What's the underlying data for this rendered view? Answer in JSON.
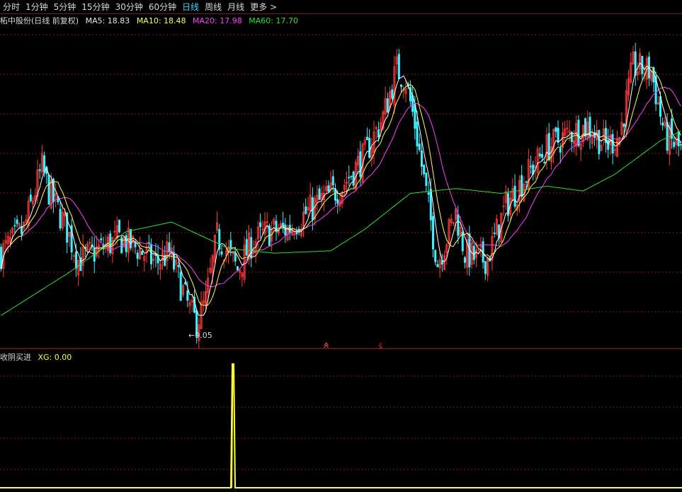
{
  "toolbar": {
    "tabs": [
      "分时",
      "1分钟",
      "5分钟",
      "15分钟",
      "30分钟",
      "60分钟",
      "日线",
      "周线",
      "月线",
      "更多"
    ],
    "active": "日线",
    "more_arrow": ">"
  },
  "header": {
    "stock": "柘中股份(日线 前复权)",
    "ma5": "MA5: 18.83",
    "ma10": "MA10: 18.48",
    "ma20": "MA20: 17.98",
    "ma60": "MA60: 17.70"
  },
  "annotations": {
    "low_label": "←9.05"
  },
  "indicator": {
    "name": "收阴买进",
    "xg": "XG: 0.00"
  },
  "colors": {
    "up": "#ff3a3a",
    "down": "#3ff0ff",
    "ma5": "#ffffff",
    "ma10": "#ffff55",
    "ma20": "#ff40ff",
    "ma60": "#30e030",
    "grid": "#7a1f1f",
    "xg": "#ffff30"
  },
  "chart_data": {
    "type": "candlestick",
    "price_range": [
      9.0,
      22.0
    ],
    "xg_signal_index": 102,
    "xg_range": [
      0,
      1
    ],
    "anchor_prices": [
      {
        "i": 0,
        "p": 12.6
      },
      {
        "i": 10,
        "p": 13.6
      },
      {
        "i": 18,
        "p": 16.2
      },
      {
        "i": 21,
        "p": 15.2
      },
      {
        "i": 28,
        "p": 13.8
      },
      {
        "i": 34,
        "p": 12.3
      },
      {
        "i": 42,
        "p": 12.7
      },
      {
        "i": 52,
        "p": 13.2
      },
      {
        "i": 60,
        "p": 12.8
      },
      {
        "i": 68,
        "p": 12.2
      },
      {
        "i": 74,
        "p": 12.6
      },
      {
        "i": 83,
        "p": 10.2
      },
      {
        "i": 86,
        "p": 9.7
      },
      {
        "i": 90,
        "p": 10.6
      },
      {
        "i": 95,
        "p": 13.3
      },
      {
        "i": 100,
        "p": 12.6
      },
      {
        "i": 104,
        "p": 11.9
      },
      {
        "i": 110,
        "p": 13.0
      },
      {
        "i": 117,
        "p": 13.5
      },
      {
        "i": 126,
        "p": 13.6
      },
      {
        "i": 138,
        "p": 14.6
      },
      {
        "i": 150,
        "p": 15.4
      },
      {
        "i": 160,
        "p": 16.7
      },
      {
        "i": 168,
        "p": 18.3
      },
      {
        "i": 174,
        "p": 20.3
      },
      {
        "i": 178,
        "p": 19.8
      },
      {
        "i": 182,
        "p": 18.0
      },
      {
        "i": 188,
        "p": 14.5
      },
      {
        "i": 192,
        "p": 12.2
      },
      {
        "i": 197,
        "p": 13.5
      },
      {
        "i": 200,
        "p": 14.3
      },
      {
        "i": 204,
        "p": 12.6
      },
      {
        "i": 210,
        "p": 12.3
      },
      {
        "i": 214,
        "p": 12.4
      },
      {
        "i": 222,
        "p": 14.6
      },
      {
        "i": 230,
        "p": 15.7
      },
      {
        "i": 240,
        "p": 17.0
      },
      {
        "i": 250,
        "p": 17.6
      },
      {
        "i": 258,
        "p": 17.9
      },
      {
        "i": 266,
        "p": 17.1
      },
      {
        "i": 272,
        "p": 17.5
      },
      {
        "i": 278,
        "p": 20.4
      },
      {
        "i": 286,
        "p": 20.2
      },
      {
        "i": 292,
        "p": 17.5
      },
      {
        "i": 299,
        "p": 16.9
      }
    ],
    "ma60_anchors": [
      {
        "i": 0,
        "p": 10.0
      },
      {
        "i": 30,
        "p": 11.8
      },
      {
        "i": 55,
        "p": 13.5
      },
      {
        "i": 75,
        "p": 13.9
      },
      {
        "i": 100,
        "p": 12.8
      },
      {
        "i": 120,
        "p": 12.6
      },
      {
        "i": 145,
        "p": 12.7
      },
      {
        "i": 160,
        "p": 13.6
      },
      {
        "i": 180,
        "p": 15.1
      },
      {
        "i": 200,
        "p": 15.3
      },
      {
        "i": 220,
        "p": 15.1
      },
      {
        "i": 240,
        "p": 15.4
      },
      {
        "i": 256,
        "p": 15.2
      },
      {
        "i": 270,
        "p": 15.9
      },
      {
        "i": 290,
        "p": 17.3
      },
      {
        "i": 299,
        "p": 17.7
      }
    ]
  }
}
